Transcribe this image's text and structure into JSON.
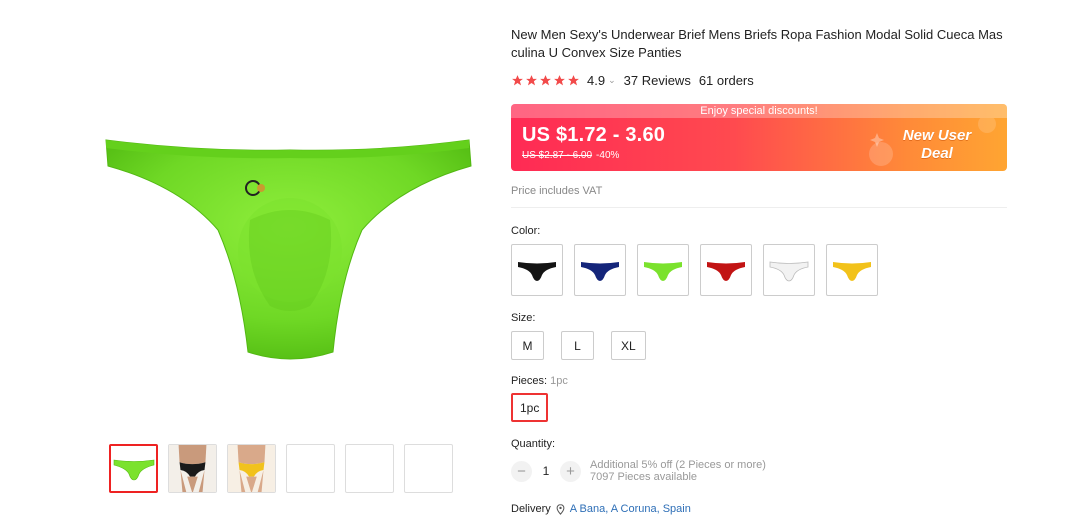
{
  "product": {
    "title": "New Men Sexy's Underwear Brief Mens Briefs Ropa Fashion Modal Solid Cueca Masculina U Convex Size Panties",
    "rating": "4.9",
    "reviews": "37 Reviews",
    "orders": "61 orders"
  },
  "price": {
    "banner_caption": "Enjoy special discounts!",
    "current": "US $1.72 - 3.60",
    "original": "US $2.87 - 6.00",
    "discount": "-40%",
    "deal_line1": "New User",
    "deal_line2": "Deal",
    "vat_note": "Price includes VAT"
  },
  "color": {
    "label": "Color:",
    "options": [
      "black",
      "navy",
      "green",
      "red",
      "white",
      "yellow"
    ]
  },
  "size": {
    "label": "Size:",
    "options": [
      "M",
      "L",
      "XL"
    ]
  },
  "pieces": {
    "label": "Pieces:",
    "selected_text": "1pc",
    "options": [
      "1pc"
    ]
  },
  "quantity": {
    "label": "Quantity:",
    "value": "1",
    "minus": "−",
    "plus": "+",
    "promo": "Additional 5% off (2 Pieces or more)",
    "available": "7097 Pieces available"
  },
  "delivery": {
    "label": "Delivery",
    "location": "A Bana, A Coruna, Spain"
  },
  "icons": {
    "star": "star-icon",
    "chevron": "chevron-down-icon",
    "location": "location-pin-icon"
  },
  "colors": {
    "accent_red": "#e22222",
    "star": "#f24a4a",
    "product_green": "#7be22d",
    "link_blue": "#2e6fb7"
  }
}
